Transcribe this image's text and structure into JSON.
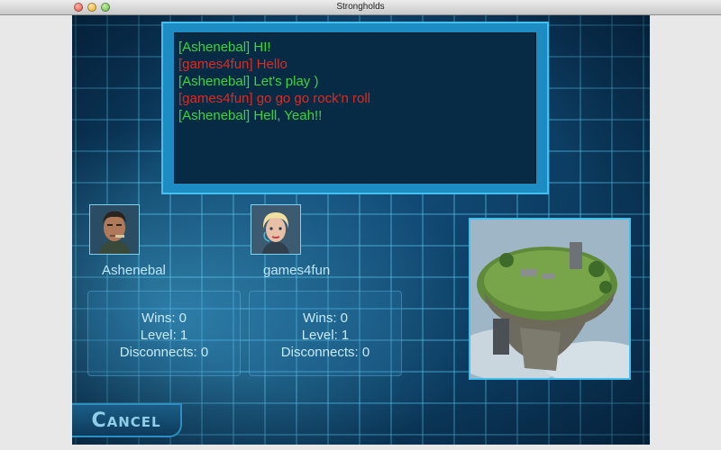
{
  "window": {
    "title": "Strongholds"
  },
  "chat": {
    "messages": [
      {
        "text": "[Ashenebal] HI!",
        "color": "#39d639"
      },
      {
        "text": "[games4fun] Hello",
        "color": "#e02a20"
      },
      {
        "text": "[Ashenebal] Let's play )",
        "color": "#39d639"
      },
      {
        "text": "[games4fun] go go go rock'n roll",
        "color": "#e02a20"
      },
      {
        "text": "[Ashenebal] Hell, Yeah!!",
        "color": "#39d639"
      }
    ]
  },
  "players": [
    {
      "name": "Ashenebal",
      "avatar_icon": "soldier-portrait-icon",
      "wins": "Wins: 0",
      "level": "Level: 1",
      "disconnects": "Disconnects: 0"
    },
    {
      "name": "games4fun",
      "avatar_icon": "woman-portrait-icon",
      "wins": "Wins: 0",
      "level": "Level: 1",
      "disconnects": "Disconnects: 0"
    }
  ],
  "map": {
    "icon": "floating-island-map-icon"
  },
  "cancel_label": "Cancel",
  "colors": {
    "accent": "#45c0ee",
    "background": "#0b3a5e",
    "text": "#c8ecff"
  }
}
